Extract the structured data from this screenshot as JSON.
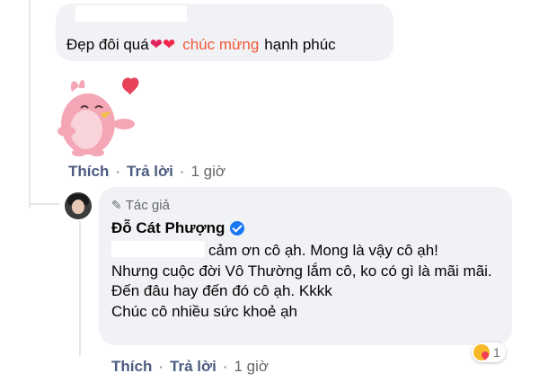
{
  "comment": {
    "text_prefix": "Đẹp đôi quá",
    "highlight": "chúc mừng",
    "text_suffix": "hạnh phúc",
    "heart_glyph": "❤",
    "actions": {
      "like": "Thích",
      "reply": "Trả lời",
      "separator": "·",
      "time": "1 giờ"
    }
  },
  "reply": {
    "author_tag": "Tác giả",
    "author_name": "Đỗ Cát Phượng",
    "lines": [
      "cảm ơn cô ạh. Mong là vậy cô ạh!",
      "Nhưng cuộc đời Vô Thường lắm cô, ko có gì là mãi mãi.",
      "Đến đâu hay đến đó cô ạh. Kkkk",
      "Chúc cô nhiều sức khoẻ ạh"
    ],
    "reaction_count": "1",
    "actions": {
      "like": "Thích",
      "reply": "Trả lời",
      "separator": "·",
      "time": "1 giờ"
    }
  },
  "colors": {
    "bubble": "#f0f2f5",
    "highlight": "#f25738",
    "verified": "#1877f2",
    "action_link": "#4c5c80"
  },
  "icons": [
    "pencil-icon",
    "verified-badge-icon",
    "care-reaction-icon",
    "heart-icon"
  ]
}
